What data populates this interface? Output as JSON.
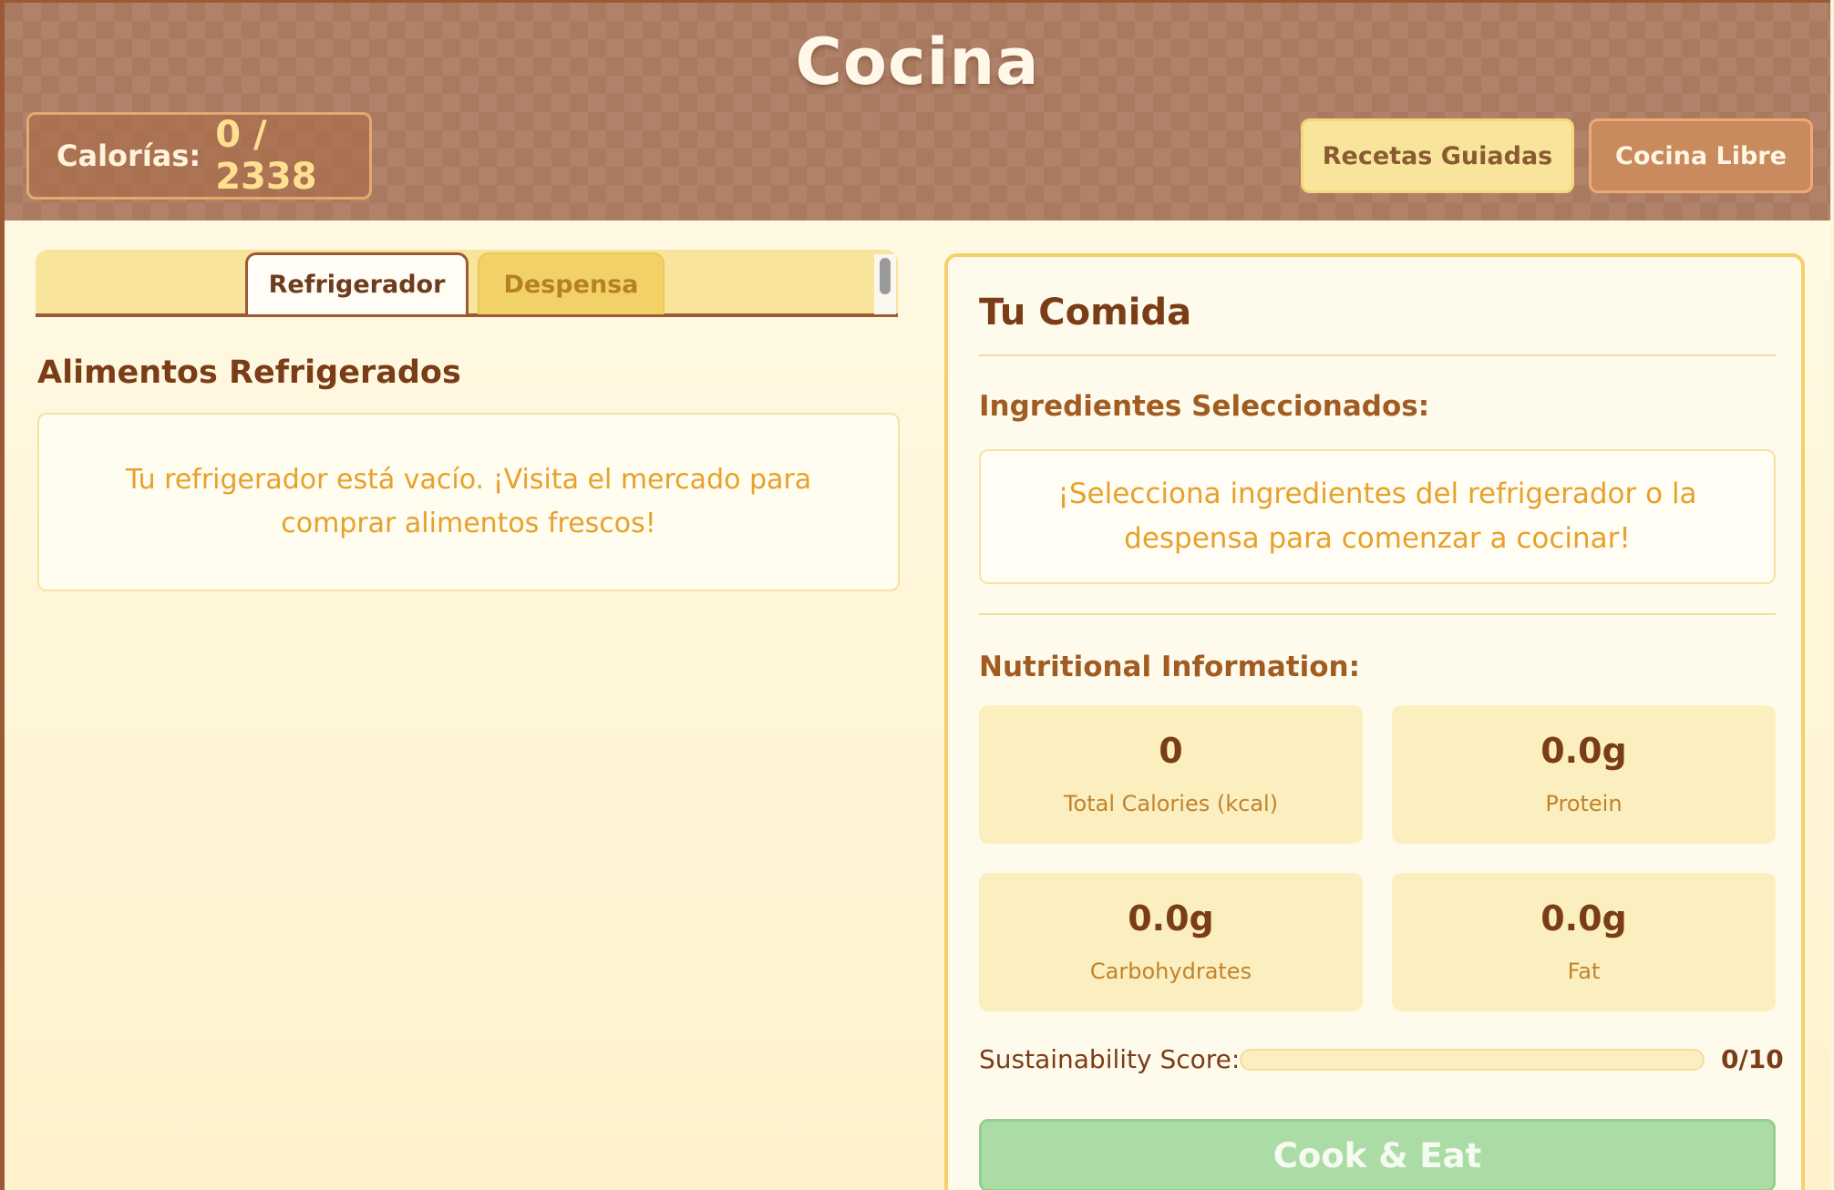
{
  "header": {
    "title": "Cocina",
    "calories_label": "Calorías:",
    "calories_value": "0 / 2338",
    "guided_recipes_label": "Recetas Guiadas",
    "free_cooking_label": "Cocina Libre"
  },
  "tabs": [
    {
      "label": "Refrigerador",
      "active": true
    },
    {
      "label": "Despensa",
      "active": false
    }
  ],
  "left": {
    "section_title": "Alimentos Refrigerados",
    "empty_message": "Tu refrigerador está vacío. ¡Visita el mercado para comprar alimentos frescos!"
  },
  "meal": {
    "title": "Tu Comida",
    "ingredients_title": "Ingredientes Seleccionados:",
    "ingredients_empty": "¡Selecciona ingredientes del refrigerador o la despensa para comenzar a cocinar!",
    "nutrition_title": "Nutritional Information:",
    "stats": [
      {
        "value": "0",
        "label": "Total Calories (kcal)"
      },
      {
        "value": "0.0g",
        "label": "Protein"
      },
      {
        "value": "0.0g",
        "label": "Carbohydrates"
      },
      {
        "value": "0.0g",
        "label": "Fat"
      }
    ],
    "sustainability_label": "Sustainability Score:",
    "sustainability_value": "0/10",
    "sustainability_fraction": 0,
    "cook_button_label": "Cook & Eat"
  },
  "colors": {
    "header_bg": "#aa7a60",
    "accent_yellow": "#f8e49a",
    "brown_text": "#7a3d18",
    "orange_text": "#e7a12c",
    "cook_green": "#acdca5"
  }
}
